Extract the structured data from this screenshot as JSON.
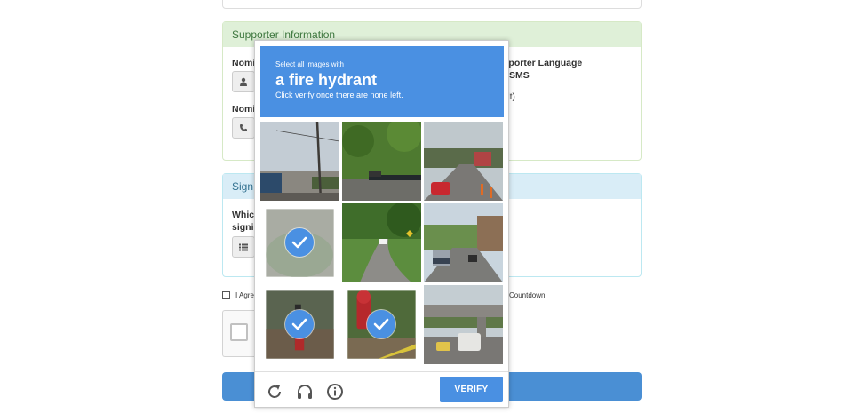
{
  "form": {
    "supporter_panel_title": "Supporter Information",
    "nominee_label_1": "Nomi",
    "nominee_label_2": "Nomi",
    "language_label_line1": "pporter Language",
    "language_label_line2": "r SMS",
    "default_text": "ult)",
    "sign_panel_title": "Sign",
    "which_line1": "Whic",
    "which_line2": "signi",
    "agree_text_left": "I Agre",
    "agree_text_right": "Countdown."
  },
  "challenge": {
    "instruction": "Select all images with",
    "target": "a fire hydrant",
    "sub_instruction": "Click verify once there are none left.",
    "tiles": [
      {
        "scene": "street-pole-building",
        "selected": false
      },
      {
        "scene": "trees-fence-road",
        "selected": false
      },
      {
        "scene": "street-red-car",
        "selected": false
      },
      {
        "scene": "blurry-grass-hydrant",
        "selected": true
      },
      {
        "scene": "curving-road-trees",
        "selected": false
      },
      {
        "scene": "street-truck",
        "selected": false
      },
      {
        "scene": "hydrant-dirt",
        "selected": true
      },
      {
        "scene": "red-hydrant-closeup",
        "selected": true
      },
      {
        "scene": "overpass-traffic",
        "selected": false
      }
    ],
    "reload_icon": "reload-icon",
    "audio_icon": "headphones-icon",
    "info_icon": "info-icon",
    "verify_label": "VERIFY"
  },
  "colors": {
    "accent": "#4a90e2",
    "panel_green_bg": "#dff0d8",
    "panel_blue_bg": "#d9edf7",
    "submit_bar": "#4a8fd4"
  }
}
